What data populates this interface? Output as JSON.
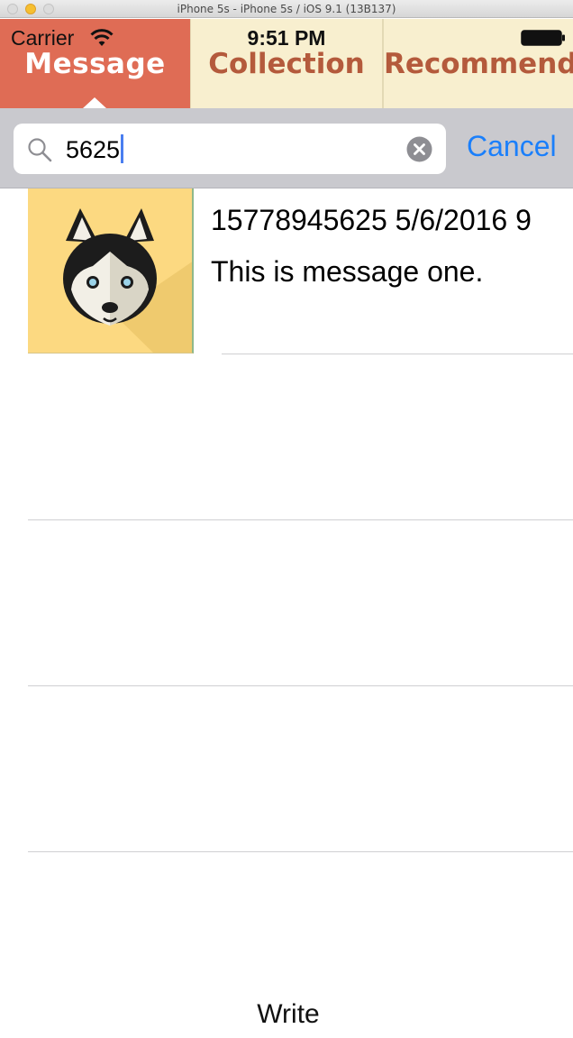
{
  "window": {
    "title": "iPhone 5s - iPhone 5s / iOS 9.1 (13B137)"
  },
  "status_bar": {
    "carrier": "Carrier",
    "time": "9:51 PM"
  },
  "tabs": [
    {
      "label": "Message",
      "selected": true
    },
    {
      "label": "Collection",
      "selected": false
    },
    {
      "label": "Recommend",
      "selected": false
    }
  ],
  "search": {
    "value": "5625",
    "cancel_label": "Cancel"
  },
  "results": [
    {
      "title": "15778945625  5/6/2016 9",
      "message": "This is message one.",
      "avatar": "husky-dog-icon"
    }
  ],
  "footer": {
    "write_label": "Write"
  },
  "colors": {
    "selected_tab": "#df6c55",
    "tab_background": "#f8efcf",
    "tab_text": "#b45a3c",
    "accent_blue": "#1a7ffb",
    "avatar_background": "#fcd981"
  }
}
